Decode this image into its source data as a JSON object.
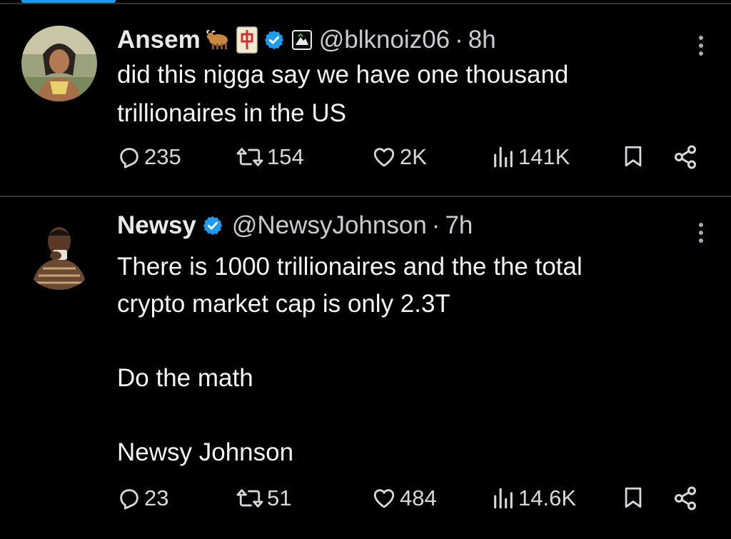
{
  "tweets": [
    {
      "name": "Ansem",
      "handle": "@blknoiz06",
      "time": "8h",
      "text": "did this nigga say we have one thousand\ntrillionaires in the US",
      "replies": "235",
      "reposts": "154",
      "likes": "2K",
      "views": "141K",
      "name_emojis": [
        "ox-emoji",
        "mahjong-red-dragon-emoji"
      ],
      "verified": true,
      "affiliate_badge": true
    },
    {
      "name": "Newsy",
      "handle": "@NewsyJohnson",
      "time": "7h",
      "text": "There is 1000 trillionaires and the the total\ncrypto market cap is only 2.3T\n\nDo the math\n\nNewsy Johnson",
      "replies": "23",
      "reposts": "51",
      "likes": "484",
      "views": "14.6K",
      "verified": true
    }
  ],
  "separator": "·",
  "colors": {
    "background": "#000000",
    "text": "#e7e9ea",
    "secondary_text": "#c9cdd1",
    "verified_blue": "#1d9bf0",
    "divider": "#2f3336"
  },
  "icons": [
    "reply-icon",
    "repost-icon",
    "like-icon",
    "views-icon",
    "bookmark-icon",
    "share-icon",
    "more-icon",
    "verified-badge-icon",
    "affiliate-badge-icon"
  ]
}
